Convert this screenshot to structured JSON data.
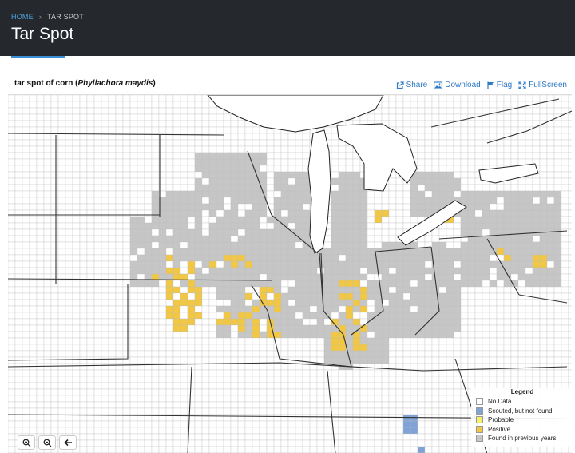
{
  "header": {
    "breadcrumb": {
      "home": "HOME",
      "separator": "›",
      "current": "TAR SPOT"
    },
    "title": "Tar Spot"
  },
  "map": {
    "title_prefix": "tar spot of corn (",
    "title_species": "Phyllachora maydis",
    "title_suffix": ")",
    "actions": [
      {
        "label": "Share",
        "icon": "share-icon"
      },
      {
        "label": "Download",
        "icon": "image-icon"
      },
      {
        "label": "Flag",
        "icon": "flag-icon"
      },
      {
        "label": "FullScreen",
        "icon": "fullscreen-icon"
      }
    ],
    "zoom_controls": [
      {
        "icon": "zoom-in-icon"
      },
      {
        "icon": "zoom-out-icon"
      },
      {
        "icon": "back-arrow-icon"
      }
    ]
  },
  "legend": {
    "title": "Legend",
    "items": [
      {
        "label": "No Data",
        "color": "#ffffff"
      },
      {
        "label": "Scouted, but not found",
        "color": "#7fa3d6"
      },
      {
        "label": "Probable",
        "color": "#f4f06a"
      },
      {
        "label": "Positive",
        "color": "#f2c744"
      },
      {
        "label": "Found in previous years",
        "color": "#c6c6c6"
      }
    ]
  },
  "colors": {
    "header_bg": "#25292d",
    "link": "#2f7ac5",
    "gray": "#c6c6c6",
    "yellow": "#f2c744",
    "blue": "#7fa3d6",
    "lake": "#ffffff"
  }
}
